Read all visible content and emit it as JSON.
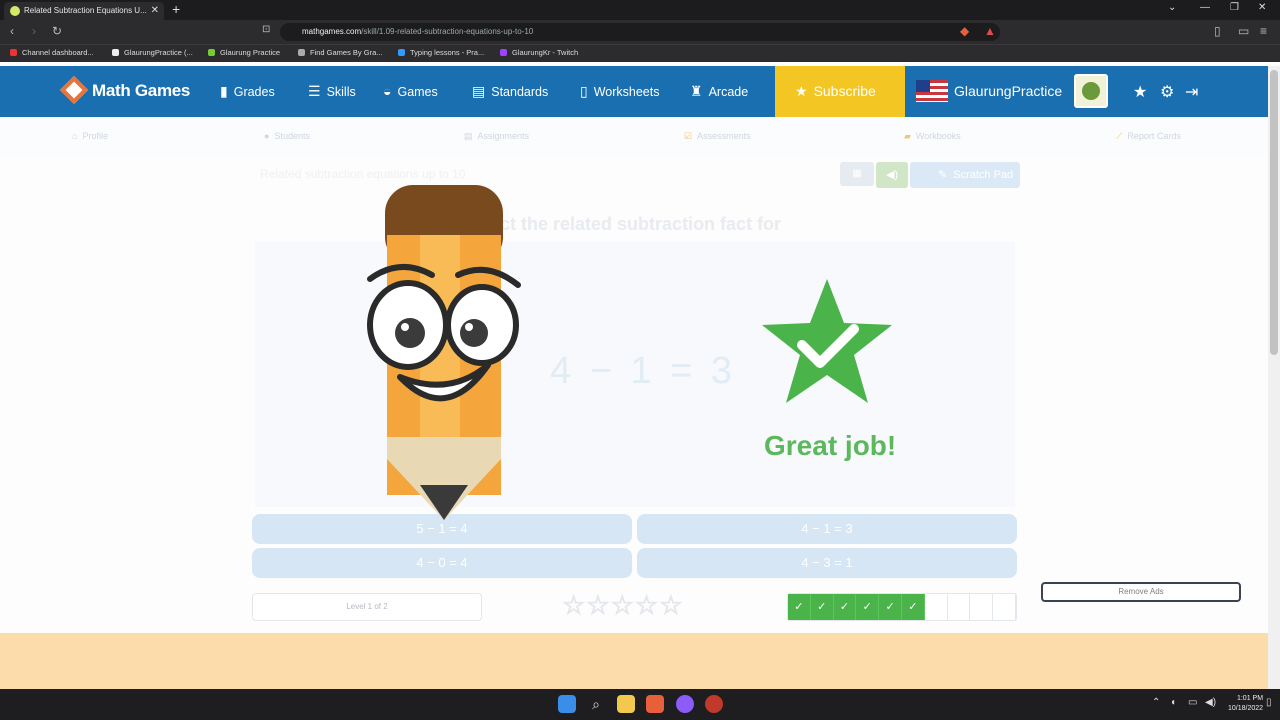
{
  "browser": {
    "tab_title": "Related Subtraction Equations U...",
    "tab_close": "✕",
    "new_tab": "+",
    "url_domain": "mathgames.com",
    "url_path": "/skill/1.09-related-subtraction-equations-up-to-10",
    "bookmarks": [
      "Channel dashboard...",
      "GlaurungPractice (...",
      "Glaurung Practice",
      "Find Games By Gra...",
      "Typing lessons - Pra...",
      "GlaurungKr - Twitch"
    ]
  },
  "header": {
    "logo": "Math Games",
    "nav": [
      "Grades",
      "Skills",
      "Games",
      "Standards",
      "Worksheets",
      "Arcade"
    ],
    "subscribe": "Subscribe",
    "username": "GlaurungPractice"
  },
  "subnav": [
    "Profile",
    "Students",
    "Assignments",
    "Assessments",
    "Workbooks",
    "Report Cards"
  ],
  "main": {
    "breadcrumb": "Related subtraction equations up to 10",
    "scratch_pad": "Scratch Pad",
    "question": "ect the related subtraction fact for",
    "equation": "4 − 1 = 3",
    "answers": [
      "5 − 1 = 4",
      "4 − 1 = 3",
      "4 − 0 = 4",
      "4 − 3 = 1"
    ],
    "level": "Level 1 of 2",
    "feedback": "Great job!",
    "remove_ads": "Remove Ads",
    "progress_total": 10,
    "progress_done": 6
  },
  "taskbar": {
    "time": "1:01 PM",
    "date": "10/18/2022"
  },
  "colors": {
    "header_blue": "#1a6fb0",
    "subscribe_yellow": "#f3c623",
    "success_green": "#4ab34a"
  }
}
